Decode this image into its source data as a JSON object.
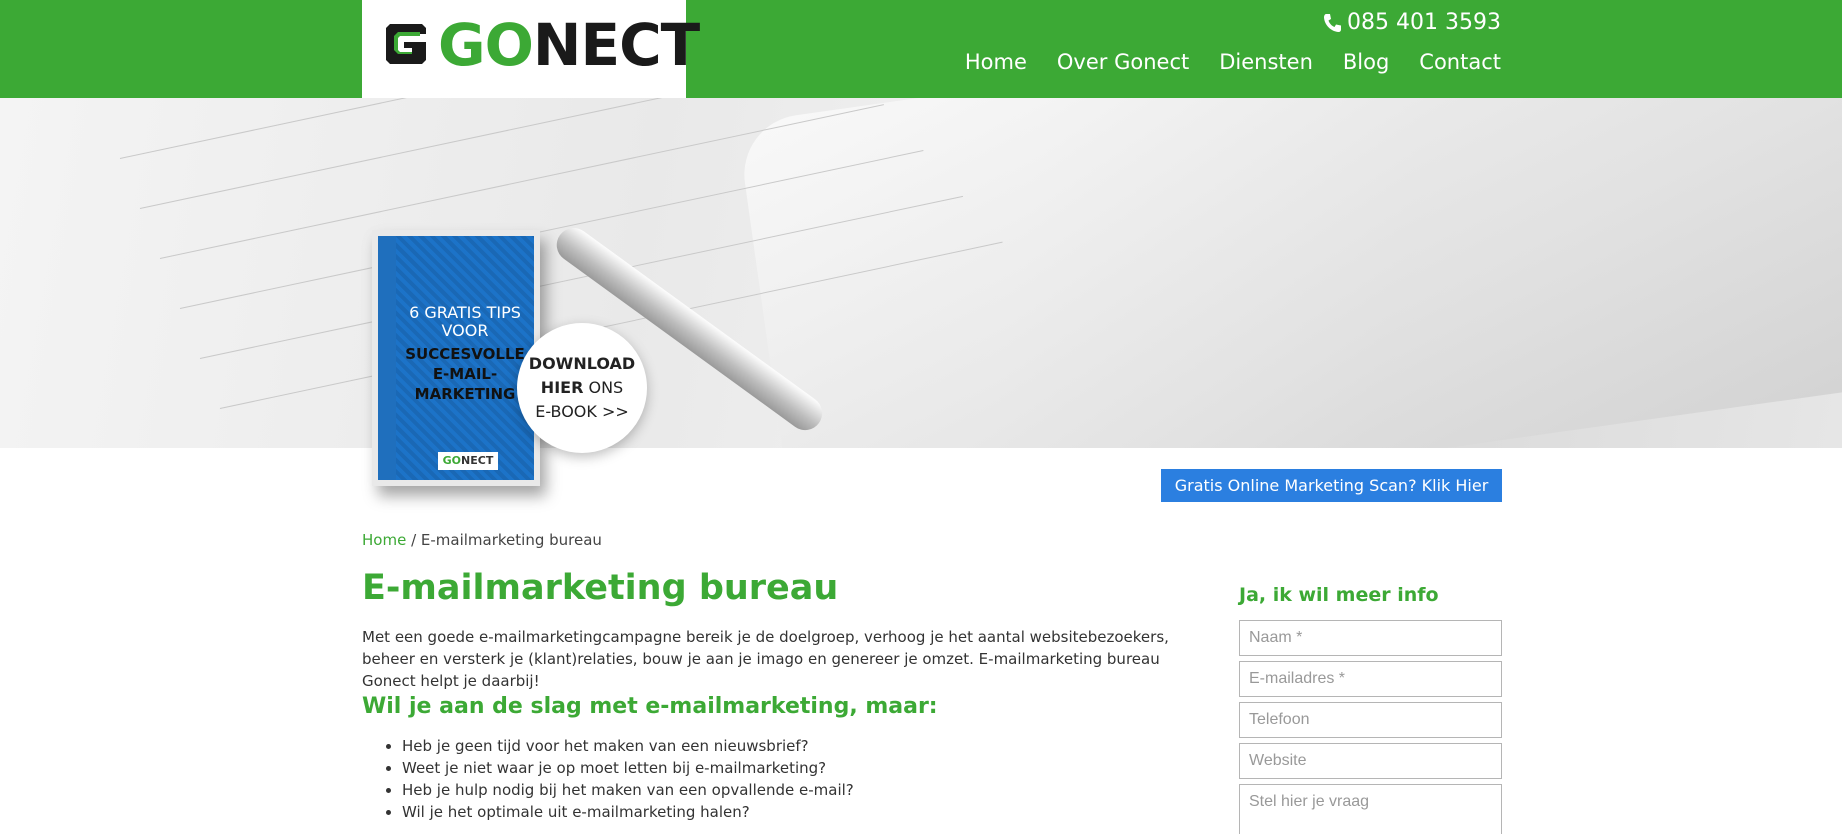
{
  "brand": {
    "logo_go": "GO",
    "logo_nect": "NECT",
    "accent": "#3ca935",
    "cta_color": "#2b7fe0"
  },
  "header": {
    "phone": "085 401 3593",
    "phone_icon": "phone-icon",
    "nav": [
      {
        "label": "Home"
      },
      {
        "label": "Over Gonect"
      },
      {
        "label": "Diensten"
      },
      {
        "label": "Blog"
      },
      {
        "label": "Contact"
      }
    ]
  },
  "hero": {
    "ebook_title_top": "6 GRATIS TIPS VOOR",
    "ebook_title_bold": "SUCCESVOLLE E-MAIL-MARKETING",
    "ebook_logo_go": "GO",
    "ebook_logo_nect": "NECT",
    "download_bold_1": "DOWNLOAD",
    "download_bold_2": "HIER",
    "download_rest_1": " ONS",
    "download_rest_2": "E-BOOK >>"
  },
  "cta": {
    "label": "Gratis Online Marketing Scan? Klik Hier >>"
  },
  "breadcrumb": {
    "home": "Home",
    "separator": " / ",
    "current": "E-mailmarketing bureau"
  },
  "main": {
    "title": "E-mailmarketing bureau",
    "intro": "Met een goede e-mailmarketingcampagne bereik je de doelgroep, verhoog je het aantal websitebezoekers, beheer en versterk je (klant)relaties, bouw je aan je imago en genereer je omzet. E-mailmarketing bureau Gonect helpt je daarbij!",
    "subtitle": "Wil je aan de slag met e-mailmarketing, maar:",
    "bullets": [
      "Heb je geen tijd voor het maken van een nieuwsbrief?",
      "Weet je niet waar je op moet letten bij e-mailmarketing?",
      "Heb je hulp nodig bij het maken van een opvallende e-mail?",
      "Wil je het optimale uit e-mailmarketing halen?"
    ]
  },
  "form": {
    "title": "Ja, ik wil meer info",
    "name_placeholder": "Naam *",
    "email_placeholder": "E-mailadres *",
    "phone_placeholder": "Telefoon",
    "website_placeholder": "Website",
    "question_placeholder": "Stel hier je vraag"
  }
}
